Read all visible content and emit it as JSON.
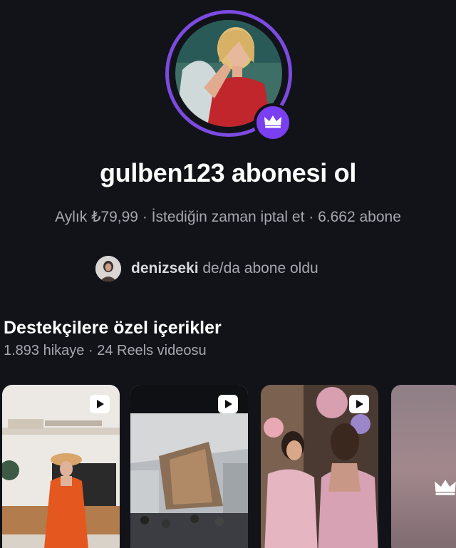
{
  "profile": {
    "avatar_alt": "gulben123 profile photo",
    "badge_icon": "crown-icon",
    "ring_color": "#7c4be0"
  },
  "header": {
    "title": "gulben123 abonesi ol",
    "meta": "Aylık ₺79,99 · İstediğin zaman iptal et · 6.662 abone"
  },
  "social_proof": {
    "username": "denizseki",
    "suffix": " de/da abone oldu"
  },
  "exclusive": {
    "title": "Destekçilere özel içerikler",
    "subtitle": "1.893 hikaye · 24 Reels videosu"
  },
  "thumbnails": [
    {
      "type": "reel",
      "icon": "play-icon"
    },
    {
      "type": "reel",
      "icon": "play-icon"
    },
    {
      "type": "reel",
      "icon": "play-icon"
    },
    {
      "type": "locked",
      "icon": "crown-icon"
    }
  ]
}
